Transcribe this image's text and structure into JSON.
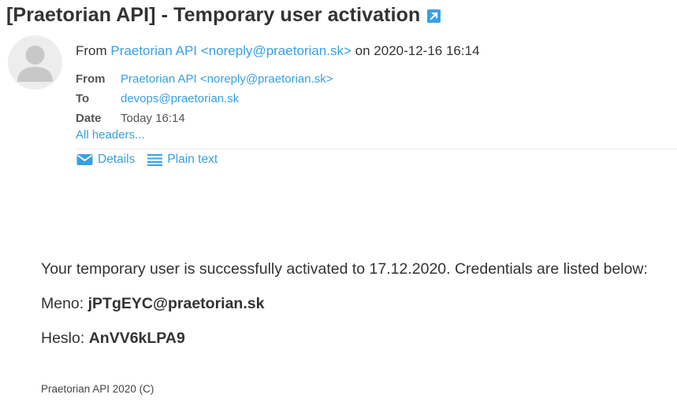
{
  "subject": "[Praetorian API] - Temporary user activation",
  "summary": {
    "from_prefix": "From",
    "sender": "Praetorian API <noreply@praetorian.sk>",
    "on_word": "on",
    "datetime": "2020-12-16 16:14"
  },
  "headers": {
    "from_label": "From",
    "from_value": "Praetorian API <noreply@praetorian.sk>",
    "to_label": "To",
    "to_value": "devops@praetorian.sk",
    "date_label": "Date",
    "date_value": "Today 16:14",
    "all_headers": "All headers..."
  },
  "view": {
    "details": "Details",
    "plain_text": "Plain text"
  },
  "body": {
    "line1": "Your temporary user is successfully activated to 17.12.2020. Credentials are listed below:",
    "username_label": "Meno:",
    "username": "jPTgEYC@praetorian.sk",
    "password_label": "Heslo:",
    "password": "AnVV6kLPA9"
  },
  "footer": "Praetorian API 2020 (C)",
  "colors": {
    "link": "#37a0e4",
    "text": "#333333",
    "avatar_bg": "#ededed",
    "avatar_fg": "#c8c8c8"
  },
  "icons": {
    "open": "open-in-new-window-icon",
    "avatar": "user-silhouette-icon",
    "details": "envelope-icon",
    "plain_text": "lines-icon"
  }
}
